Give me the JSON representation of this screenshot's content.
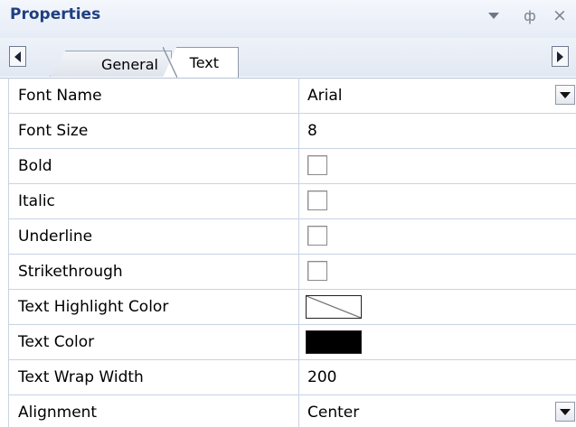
{
  "panel": {
    "title": "Properties"
  },
  "titlebar": {
    "pin_glyph": "ф",
    "close_glyph": "×"
  },
  "tabs": [
    {
      "label": "General",
      "selected": false
    },
    {
      "label": "Text",
      "selected": true
    }
  ],
  "properties": [
    {
      "name": "Font Name",
      "value": "Arial",
      "kind": "dropdown"
    },
    {
      "name": "Font Size",
      "value": "8",
      "kind": "text"
    },
    {
      "name": "Bold",
      "value": false,
      "kind": "checkbox"
    },
    {
      "name": "Italic",
      "value": false,
      "kind": "checkbox"
    },
    {
      "name": "Underline",
      "value": false,
      "kind": "checkbox"
    },
    {
      "name": "Strikethrough",
      "value": false,
      "kind": "checkbox"
    },
    {
      "name": "Text Highlight Color",
      "value": "none",
      "kind": "color"
    },
    {
      "name": "Text Color",
      "value": "#000000",
      "kind": "color"
    },
    {
      "name": "Text Wrap Width",
      "value": "200",
      "kind": "text"
    },
    {
      "name": "Alignment",
      "value": "Center",
      "kind": "dropdown"
    }
  ],
  "colors": {
    "title": "#1f3f7f",
    "grid_line": "#c9d3e3",
    "header_bg": "#e6ecf6"
  }
}
